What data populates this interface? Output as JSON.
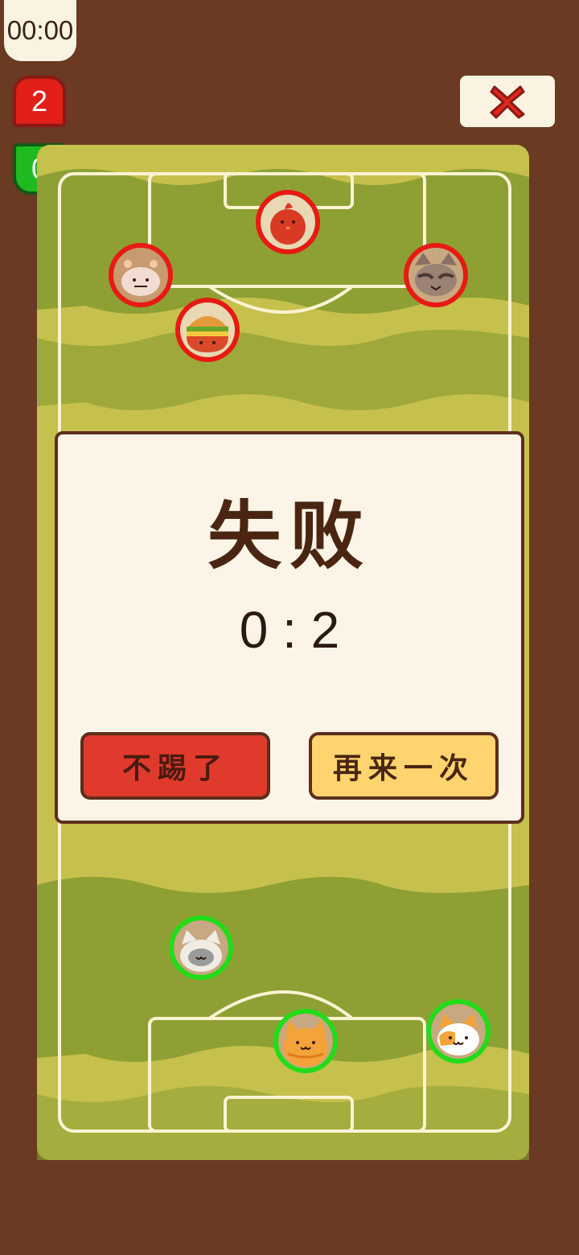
{
  "timer": "00:00",
  "scores": {
    "red": "2",
    "green": "0"
  },
  "dialog": {
    "title": "失败",
    "score": "0 : 2",
    "quit_label": "不踢了",
    "retry_label": "再来一次"
  },
  "colors": {
    "background": "#6a3a22",
    "field_light": "#c6c04c",
    "field_dark": "#8ea034",
    "enemy_ring": "#e81a14",
    "ally_ring": "#22dc1a"
  },
  "players": {
    "enemies": [
      "bird",
      "alien",
      "burger",
      "raccoon"
    ],
    "allies": [
      "siamese-cat",
      "tabby-cat",
      "calico-cat"
    ]
  }
}
